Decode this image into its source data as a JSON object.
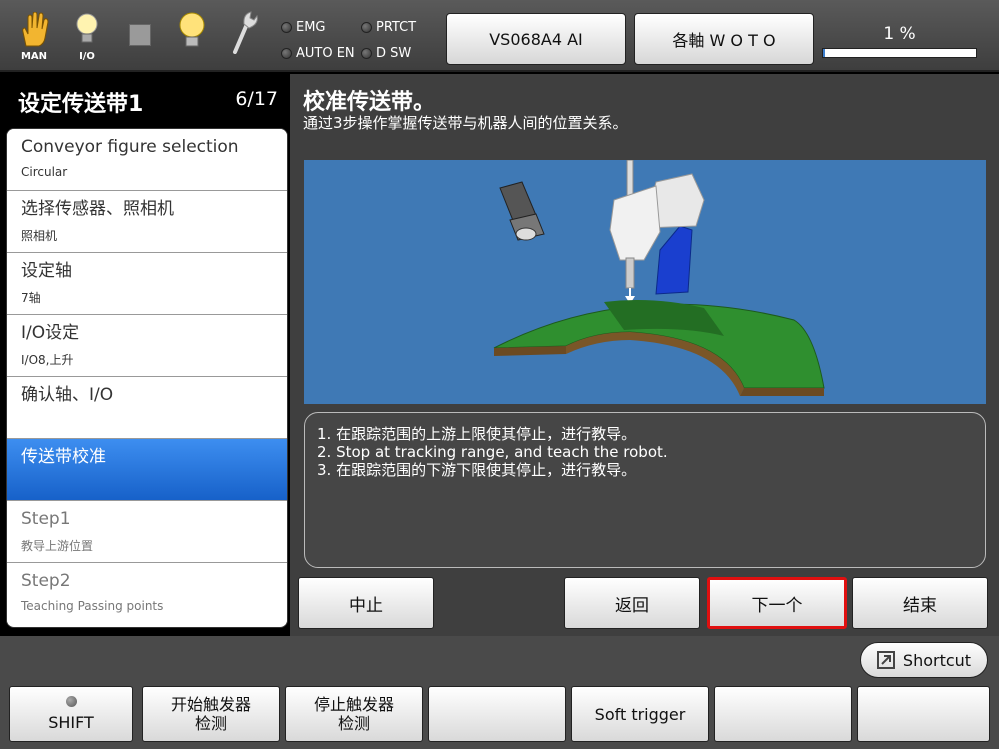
{
  "status_bar": {
    "icons": [
      {
        "name": "hand-icon",
        "caption": "MAN"
      },
      {
        "name": "io-lightbulb-icon",
        "caption": "I/O"
      },
      {
        "name": "stop-square-icon",
        "caption": ""
      },
      {
        "name": "lightbulb-icon",
        "caption": ""
      },
      {
        "name": "wrench-icon",
        "caption": ""
      }
    ],
    "lamps": {
      "emg": "EMG",
      "prtct": "PRTCT",
      "auto_en": "AUTO EN",
      "d_sw": "D SW"
    },
    "robot_button": "VS068A4 AI",
    "axis_button": "各軸  W O T O",
    "speed_label": "1 %",
    "speed_percent": 1
  },
  "left_panel": {
    "title": "设定传送带1",
    "page": "6/17",
    "steps": [
      {
        "title": "Conveyor figure selection",
        "sub": "Circular"
      },
      {
        "title": "选择传感器、照相机",
        "sub": "照相机"
      },
      {
        "title": "设定轴",
        "sub": "7轴"
      },
      {
        "title": "I/O设定",
        "sub": "I/O8,上升"
      },
      {
        "title": "确认轴、I/O",
        "sub": ""
      },
      {
        "title": "传送带校准",
        "sub": ""
      },
      {
        "title": "Step1",
        "sub": "教导上游位置"
      },
      {
        "title": "Step2",
        "sub": "Teaching Passing points"
      }
    ]
  },
  "main": {
    "title": "校准传送带。",
    "subtitle": "通过3步操作掌握传送带与机器人间的位置关系。",
    "instructions": [
      "1. 在跟踪范围的上游上限使其停止，进行教导。",
      "2. Stop at tracking range, and teach the robot.",
      "3. 在跟踪范围的下游下限使其停止，进行教导。"
    ],
    "buttons": {
      "abort": "中止",
      "back": "返回",
      "next": "下一个",
      "finish": "结束"
    }
  },
  "bottom": {
    "shortcut": "Shortcut",
    "shift": "SHIFT",
    "start_trigger": [
      "开始触发器",
      "检测"
    ],
    "stop_trigger": [
      "停止触发器",
      "检测"
    ],
    "soft_trigger": "Soft trigger"
  },
  "colors": {
    "active_step": "#1f6fd8",
    "scene_background": "#3f79b5",
    "conveyor_green": "#2f8f2f",
    "next_button_border": "#e01010"
  }
}
